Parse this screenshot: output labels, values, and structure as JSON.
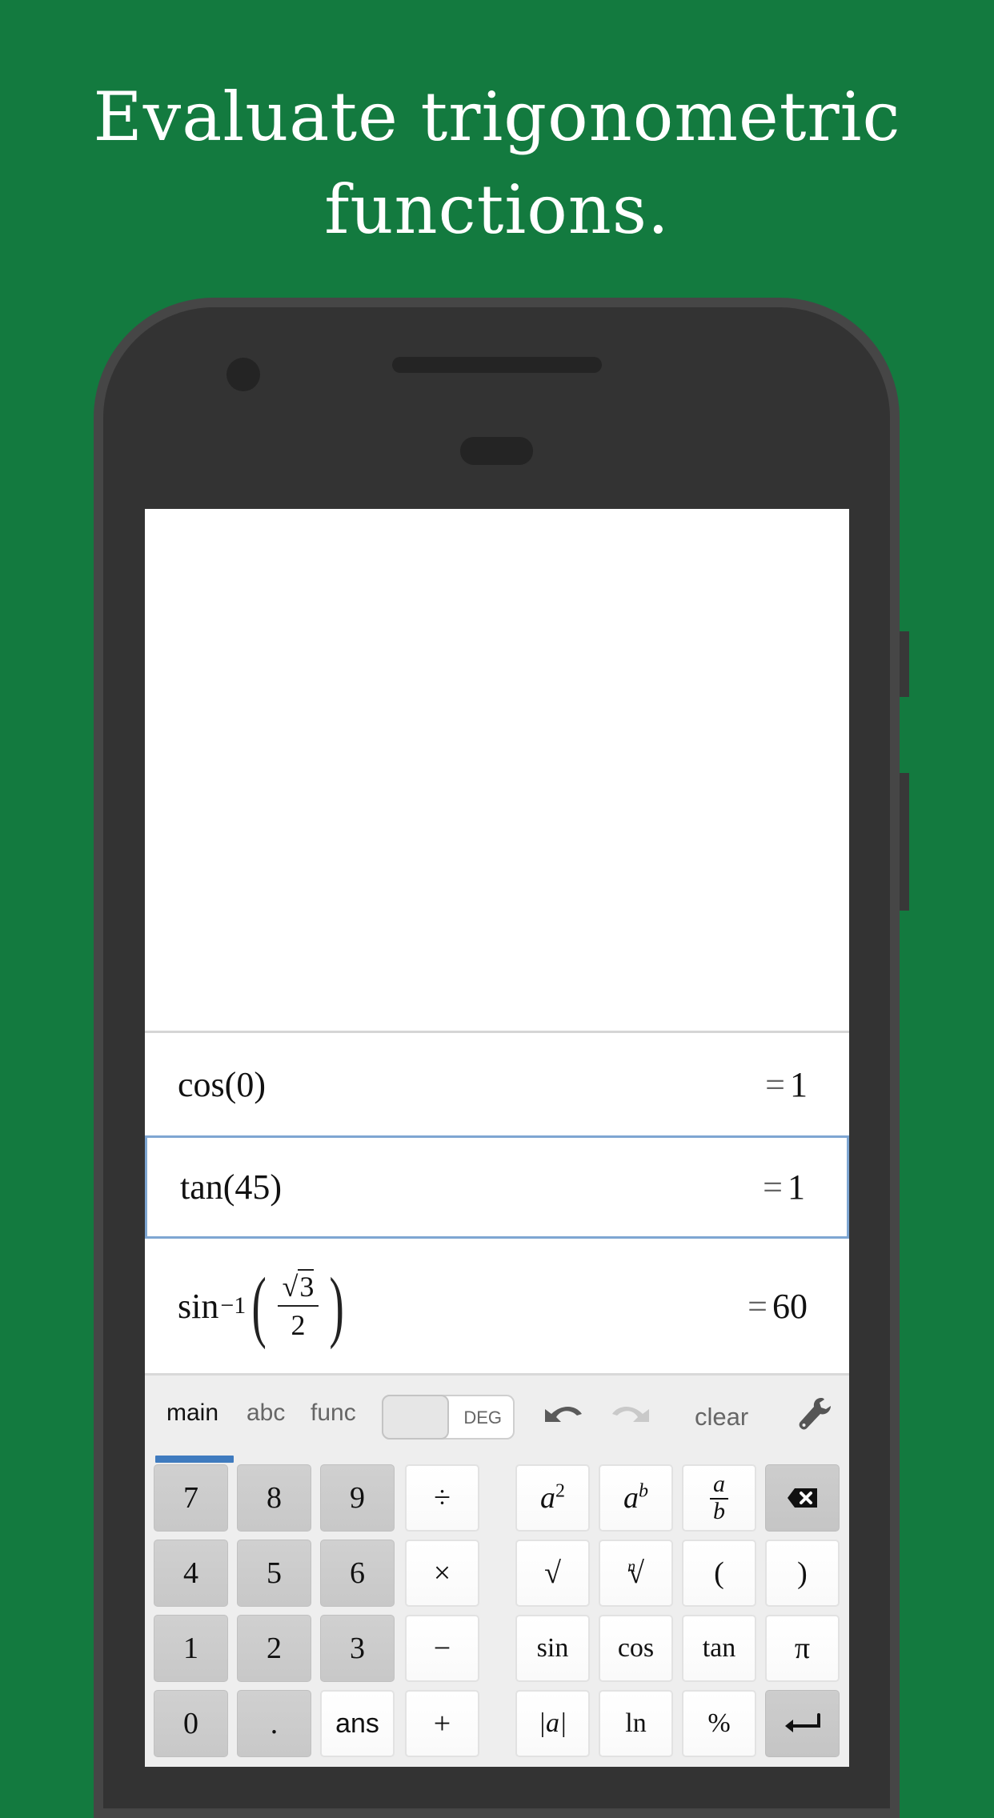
{
  "headline": {
    "line1": "Evaluate trigonometric",
    "line2": "functions."
  },
  "colors": {
    "background": "#137A3F",
    "phone_body": "#333333",
    "selected_border": "#7ea6d2",
    "tab_underline": "#3f7bbf"
  },
  "expressions": [
    {
      "func": "cos",
      "open": "(",
      "arg": "0",
      "close": ")",
      "equals": "=",
      "result": "1",
      "selected": false
    },
    {
      "func": "tan",
      "open": "(",
      "arg": "45",
      "close": ")",
      "equals": "=",
      "result": "1",
      "selected": true
    },
    {
      "func": "sin",
      "exponent": "−1",
      "open": "(",
      "radical": "√",
      "radicand": "3",
      "denominator": "2",
      "close": ")",
      "equals": "=",
      "result": "60",
      "selected": false
    }
  ],
  "keypad": {
    "tabs": [
      {
        "label": "main",
        "active": true
      },
      {
        "label": "abc",
        "active": false
      },
      {
        "label": "func",
        "active": false
      }
    ],
    "angle_mode": {
      "label": "DEG",
      "state": "off"
    },
    "undo_icon": "undo-arrow",
    "redo_icon": "redo-arrow",
    "clear_label": "clear",
    "settings_icon": "wrench",
    "keys": {
      "k7": "7",
      "k8": "8",
      "k9": "9",
      "divide": "÷",
      "k4": "4",
      "k5": "5",
      "k6": "6",
      "multiply": "×",
      "k1": "1",
      "k2": "2",
      "k3": "3",
      "minus": "−",
      "k0": "0",
      "dot": ".",
      "ans": "ans",
      "plus": "+",
      "square_base": "a",
      "square_exp": "2",
      "power_base": "a",
      "power_exp": "b",
      "frac_num": "a",
      "frac_den": "b",
      "backspace_icon": "backspace",
      "sqrt": "√",
      "nthroot_index": "n",
      "nthroot": "√",
      "lparen": "(",
      "rparen": ")",
      "sin": "sin",
      "cos": "cos",
      "tan": "tan",
      "pi": "π",
      "abs": "|a|",
      "ln": "ln",
      "percent": "%",
      "enter_icon": "enter"
    }
  }
}
